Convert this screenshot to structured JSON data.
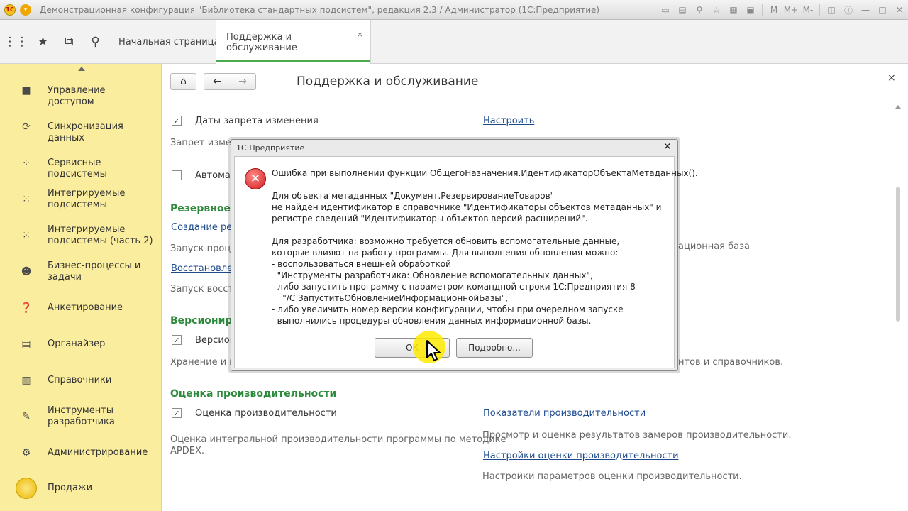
{
  "window": {
    "title": "Демонстрационная конфигурация \"Библиотека стандартных подсистем\", редакция 2.3 / Администратор  (1С:Предприятие)",
    "logo_text": "1С"
  },
  "tabs": [
    {
      "label": "Начальная страница"
    },
    {
      "label": "Поддержка и обслуживание",
      "close": "×"
    }
  ],
  "sidebar": {
    "items": [
      {
        "label": "Управление доступом",
        "icon": "lock-icon"
      },
      {
        "label": "Синхронизация данных",
        "icon": "sync-icon"
      },
      {
        "label": "Сервисные подсистемы",
        "icon": "services-icon"
      },
      {
        "label": "Интегрируемые подсистемы",
        "icon": "integrated-icon"
      },
      {
        "label": "Интегрируемые подсистемы (часть 2)",
        "icon": "integrated-icon"
      },
      {
        "label": "Бизнес-процессы и задачи",
        "icon": "users-icon"
      },
      {
        "label": "Анкетирование",
        "icon": "question-icon"
      },
      {
        "label": "Органайзер",
        "icon": "organizer-icon"
      },
      {
        "label": "Справочники",
        "icon": "catalogs-icon"
      },
      {
        "label": "Инструменты разработчика",
        "icon": "wrench-icon"
      },
      {
        "label": "Администрирование",
        "icon": "gear-icon"
      },
      {
        "label": "Продажи",
        "icon": "sales-icon"
      }
    ]
  },
  "main": {
    "title": "Поддержка и обслуживание",
    "close": "×",
    "rows": {
      "dates_lock_label": "Даты запрета изменения",
      "dates_lock_checked": true,
      "configure_link": "Настроить",
      "dates_lock_desc": "Запрет измен",
      "auto_label": "Автомат",
      "backup_section": "Резервное",
      "backup_create_link": "Создание рез",
      "backup_desc": "Запуск процед",
      "infobase_text": "ационная база",
      "restore_link": "Восстановлен",
      "restore_desc": "Запуск восста",
      "versioning_section": "Версиониро",
      "versioning_label": "Версион",
      "versioning_checked": true,
      "versioning_desc": "Хранение и пр",
      "versioning_desc_right": "нтов и справочников.",
      "perf_section": "Оценка производительности",
      "perf_label": "Оценка производительности",
      "perf_checked": true,
      "perf_desc_1": "Оценка интегральной производительности программы по методике",
      "perf_desc_2": "APDEX.",
      "perf_indicators_link": "Показатели производительности",
      "perf_indicators_desc": "Просмотр и оценка результатов замеров производительности.",
      "perf_settings_link": "Настройки оценки производительности",
      "perf_settings_desc": "Настройки параметров оценки производительности."
    }
  },
  "dialog": {
    "title": "1С:Предприятие",
    "close": "✕",
    "lines": [
      "Ошибка при выполнении функции ОбщегоНазначения.ИдентификаторОбъектаМетаданных().",
      "Для объекта метаданных \"Документ.РезервированиеТоваров\"",
      "не найден идентификатор в справочнике \"Идентификаторы объектов метаданных\" и",
      "регистре сведений \"Идентификаторы объектов версий расширений\".",
      "Для разработчика: возможно требуется обновить вспомогательные данные,",
      "которые влияют на работу программы. Для выполнения обновления можно:",
      "- воспользоваться внешней обработкой",
      "  \"Инструменты разработчика: Обновление вспомогательных данных\",",
      "- либо запустить программу с параметром командной строки 1С:Предприятия 8",
      "    \"/С ЗапуститьОбновлениеИнформационнойБазы\",",
      "- либо увеличить номер версии конфигурации, чтобы при очередном запуске",
      "  выполнились процедуры обновления данных информационной базы."
    ],
    "ok_label": "ОК",
    "more_label": "Подробно..."
  }
}
